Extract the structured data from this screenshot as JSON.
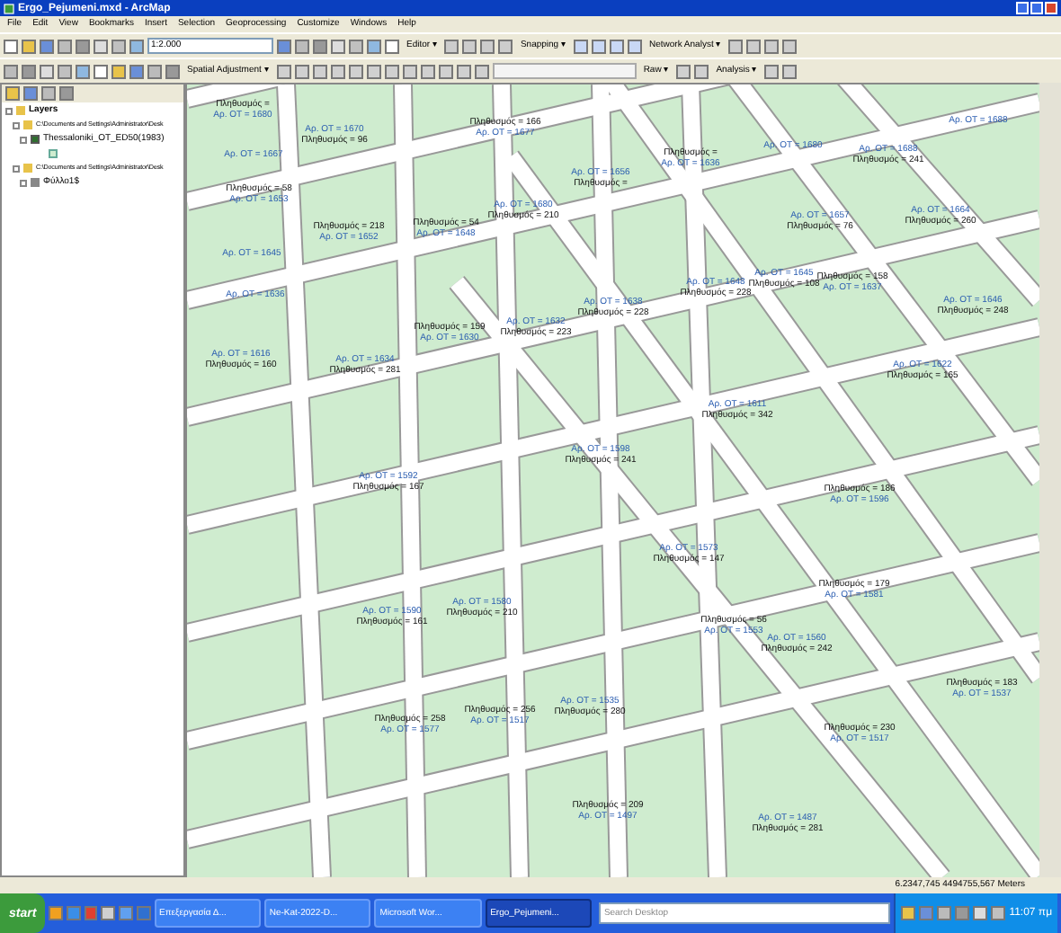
{
  "window": {
    "title": "Ergo_Pejumeni.mxd - ArcMap"
  },
  "menu": [
    "File",
    "Edit",
    "View",
    "Bookmarks",
    "Insert",
    "Selection",
    "Geoprocessing",
    "Customize",
    "Windows",
    "Help"
  ],
  "toolbar_1": {
    "scale": "1:2.000",
    "dropdowns": [
      "Editor ▾",
      "Snapping ▾",
      "Network Analyst ▾"
    ]
  },
  "toolbar_2": {
    "dropdowns": [
      "Spatial Adjustment ▾",
      "Raw ▾",
      "Analysis ▾"
    ]
  },
  "toc": {
    "root": "Layers",
    "children": [
      {
        "label": "C:\\Documents and Settings\\Administrator\\Desk",
        "kind": "folder",
        "children": [
          {
            "label": "Thessaloniki_OT_ED50(1983)",
            "kind": "layer",
            "checked": true
          }
        ]
      },
      {
        "label": "C:\\Documents and Settings\\Administrator\\Desk",
        "kind": "folder",
        "children": [
          {
            "label": "Φύλλο1$",
            "kind": "table"
          }
        ]
      }
    ]
  },
  "map": {
    "labels": [
      {
        "lines": [
          {
            "kind": "population",
            "text": "Πληθυσμός ="
          },
          {
            "kind": "ot",
            "text": "Αρ. ΟΤ = 1680"
          }
        ]
      },
      {
        "lines": [
          {
            "kind": "ot",
            "text": "Αρ. ΟΤ = 1670"
          },
          {
            "kind": "population",
            "text": "Πληθυσμός = 96"
          }
        ]
      },
      {
        "lines": [
          {
            "kind": "population",
            "text": "Πληθυσμός = 166"
          },
          {
            "kind": "ot",
            "text": "Αρ. ΟΤ = 1677"
          }
        ]
      },
      {
        "lines": [
          {
            "kind": "ot",
            "text": "Αρ. ΟΤ = 1667"
          }
        ]
      },
      {
        "lines": [
          {
            "kind": "ot",
            "text": "Αρ. ΟΤ = 1656"
          },
          {
            "kind": "population",
            "text": "Πληθυσμός ="
          }
        ]
      },
      {
        "lines": [
          {
            "kind": "population",
            "text": "Πληθυσμός = 58"
          },
          {
            "kind": "ot",
            "text": "Αρ. ΟΤ = 1653"
          }
        ]
      },
      {
        "lines": [
          {
            "kind": "ot",
            "text": "Αρ. ΟΤ = 1680"
          },
          {
            "kind": "population",
            "text": "Πληθυσμός = 210"
          }
        ]
      },
      {
        "lines": [
          {
            "kind": "population",
            "text": "Πληθυσμός = 218"
          },
          {
            "kind": "ot",
            "text": "Αρ. ΟΤ = 1652"
          }
        ]
      },
      {
        "lines": [
          {
            "kind": "population",
            "text": "Πληθυσμός = 54"
          },
          {
            "kind": "ot",
            "text": "Αρ. ΟΤ = 1648"
          }
        ]
      },
      {
        "lines": [
          {
            "kind": "ot",
            "text": "Αρ. ΟΤ = 1645"
          }
        ]
      },
      {
        "lines": [
          {
            "kind": "ot",
            "text": "Αρ. ΟΤ = 1636"
          }
        ]
      },
      {
        "lines": [
          {
            "kind": "ot",
            "text": "Αρ. ΟΤ = 1638"
          },
          {
            "kind": "population",
            "text": "Πληθυσμός = 228"
          }
        ]
      },
      {
        "lines": [
          {
            "kind": "population",
            "text": "Πληθυσμός = 159"
          },
          {
            "kind": "ot",
            "text": "Αρ. ΟΤ = 1630"
          }
        ]
      },
      {
        "lines": [
          {
            "kind": "ot",
            "text": "Αρ. ΟΤ = 1632"
          },
          {
            "kind": "population",
            "text": "Πληθυσμός = 223"
          }
        ]
      },
      {
        "lines": [
          {
            "kind": "ot",
            "text": "Αρ. ΟΤ = 1616"
          },
          {
            "kind": "population",
            "text": "Πληθυσμός = 160"
          }
        ]
      },
      {
        "lines": [
          {
            "kind": "ot",
            "text": "Αρ. ΟΤ = 1634"
          },
          {
            "kind": "population",
            "text": "Πληθυσμός = 281"
          }
        ]
      },
      {
        "lines": [
          {
            "kind": "population",
            "text": "Πληθυσμός ="
          },
          {
            "kind": "ot",
            "text": "Αρ. ΟΤ = 1636"
          }
        ]
      },
      {
        "lines": [
          {
            "kind": "ot",
            "text": "Αρ. ΟΤ = 1680"
          }
        ]
      },
      {
        "lines": [
          {
            "kind": "ot",
            "text": "Αρ. ΟΤ = 1688"
          },
          {
            "kind": "population",
            "text": "Πληθυσμός = 241"
          }
        ]
      },
      {
        "lines": [
          {
            "kind": "ot",
            "text": "Αρ. ΟΤ = 1688"
          }
        ]
      },
      {
        "lines": [
          {
            "kind": "ot",
            "text": "Αρ. ΟΤ = 1657"
          },
          {
            "kind": "population",
            "text": "Πληθυσμός = 76"
          }
        ]
      },
      {
        "lines": [
          {
            "kind": "ot",
            "text": "Αρ. ΟΤ = 1664"
          },
          {
            "kind": "population",
            "text": "Πληθυσμός = 260"
          }
        ]
      },
      {
        "lines": [
          {
            "kind": "ot",
            "text": "Αρ. ΟΤ = 1648"
          },
          {
            "kind": "population",
            "text": "Πληθυσμός = 228"
          }
        ]
      },
      {
        "lines": [
          {
            "kind": "ot",
            "text": "Αρ. ΟΤ = 1645"
          },
          {
            "kind": "population",
            "text": "Πληθυσμός = 108"
          }
        ]
      },
      {
        "lines": [
          {
            "kind": "population",
            "text": "Πληθυσμός = 158"
          },
          {
            "kind": "ot",
            "text": "Αρ. ΟΤ = 1637"
          }
        ]
      },
      {
        "lines": [
          {
            "kind": "ot",
            "text": "Αρ. ΟΤ = 1646"
          },
          {
            "kind": "population",
            "text": "Πληθυσμός = 248"
          }
        ]
      },
      {
        "lines": [
          {
            "kind": "ot",
            "text": "Αρ. ΟΤ = 1622"
          },
          {
            "kind": "population",
            "text": "Πληθυσμός = 165"
          }
        ]
      },
      {
        "lines": [
          {
            "kind": "ot",
            "text": "Αρ. ΟΤ = 1592"
          },
          {
            "kind": "population",
            "text": "Πληθυσμός = 167"
          }
        ]
      },
      {
        "lines": [
          {
            "kind": "ot",
            "text": "Αρ. ΟΤ = 1598"
          },
          {
            "kind": "population",
            "text": "Πληθυσμός = 241"
          }
        ]
      },
      {
        "lines": [
          {
            "kind": "ot",
            "text": "Αρ. ΟΤ = 1611"
          },
          {
            "kind": "population",
            "text": "Πληθυσμός = 342"
          }
        ]
      },
      {
        "lines": [
          {
            "kind": "population",
            "text": "Πληθυσμός = 186"
          },
          {
            "kind": "ot",
            "text": "Αρ. ΟΤ = 1596"
          }
        ]
      },
      {
        "lines": [
          {
            "kind": "ot",
            "text": "Αρ. ΟΤ = 1590"
          },
          {
            "kind": "population",
            "text": "Πληθυσμός = 161"
          }
        ]
      },
      {
        "lines": [
          {
            "kind": "ot",
            "text": "Αρ. ΟΤ = 1580"
          },
          {
            "kind": "population",
            "text": "Πληθυσμός = 210"
          }
        ]
      },
      {
        "lines": [
          {
            "kind": "ot",
            "text": "Αρ. ΟΤ = 1573"
          },
          {
            "kind": "population",
            "text": "Πληθυσμός = 147"
          }
        ]
      },
      {
        "lines": [
          {
            "kind": "population",
            "text": "Πληθυσμός = 56"
          },
          {
            "kind": "ot",
            "text": "Αρ. ΟΤ = 1553"
          }
        ]
      },
      {
        "lines": [
          {
            "kind": "ot",
            "text": "Αρ. ΟΤ = 1560"
          },
          {
            "kind": "population",
            "text": "Πληθυσμός = 242"
          }
        ]
      },
      {
        "lines": [
          {
            "kind": "population",
            "text": "Πληθυσμός = 179"
          },
          {
            "kind": "ot",
            "text": "Αρ. ΟΤ = 1581"
          }
        ]
      },
      {
        "lines": [
          {
            "kind": "population",
            "text": "Πληθυσμός = 258"
          },
          {
            "kind": "ot",
            "text": "Αρ. ΟΤ = 1577"
          }
        ]
      },
      {
        "lines": [
          {
            "kind": "population",
            "text": "Πληθυσμός = 256"
          },
          {
            "kind": "ot",
            "text": "Αρ. ΟΤ = 1517"
          }
        ]
      },
      {
        "lines": [
          {
            "kind": "ot",
            "text": "Αρ. ΟΤ = 1535"
          },
          {
            "kind": "population",
            "text": "Πληθυσμός = 280"
          }
        ]
      },
      {
        "lines": [
          {
            "kind": "population",
            "text": "Πληθυσμός = 209"
          },
          {
            "kind": "ot",
            "text": "Αρ. ΟΤ = 1497"
          }
        ]
      },
      {
        "lines": [
          {
            "kind": "ot",
            "text": "Αρ. ΟΤ = 1487"
          },
          {
            "kind": "population",
            "text": "Πληθυσμός = 281"
          }
        ]
      },
      {
        "lines": [
          {
            "kind": "population",
            "text": "Πληθυσμός = 230"
          },
          {
            "kind": "ot",
            "text": "Αρ. ΟΤ = 1517"
          }
        ]
      },
      {
        "lines": [
          {
            "kind": "population",
            "text": "Πληθυσμός = 183"
          },
          {
            "kind": "ot",
            "text": "Αρ. ΟΤ = 1537"
          }
        ]
      }
    ]
  },
  "status_bar": {
    "coordinates": "6.2347,745  4494755,567 Meters"
  },
  "taskbar": {
    "start": "start",
    "tasks": [
      {
        "label": "Επεξεργασία Δ...",
        "selected": false
      },
      {
        "label": "Ne-Kat-2022-D...",
        "selected": false
      },
      {
        "label": "Microsoft Wor...",
        "selected": false
      },
      {
        "label": "Ergo_Pejumeni...",
        "selected": true
      }
    ],
    "search": {
      "placeholder": "Search Desktop"
    },
    "clock": "11:07 πμ"
  }
}
